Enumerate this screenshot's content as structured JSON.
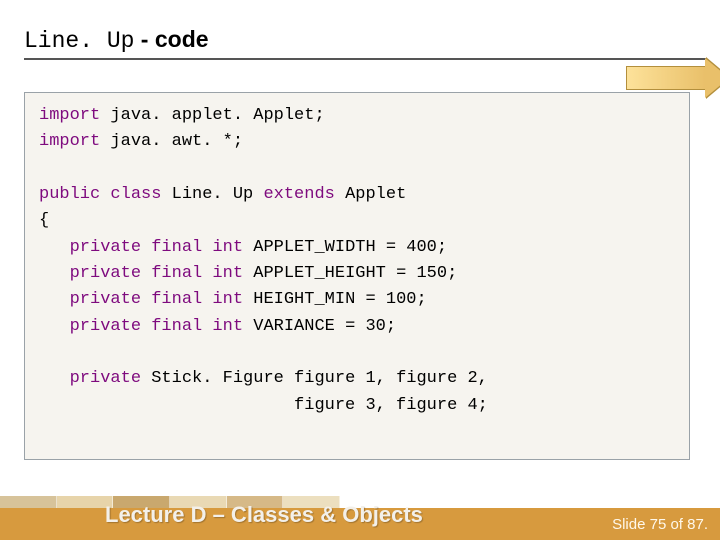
{
  "heading": {
    "mono": "Line. Up",
    "suffix": " - code"
  },
  "code": {
    "tokens": [
      {
        "t": "import",
        "k": true
      },
      {
        "t": " java. applet. Applet;\n"
      },
      {
        "t": "import",
        "k": true
      },
      {
        "t": " java. awt. *;\n"
      },
      {
        "t": "\n"
      },
      {
        "t": "public class",
        "k": true
      },
      {
        "t": " Line. Up "
      },
      {
        "t": "extends",
        "k": true
      },
      {
        "t": " Applet\n"
      },
      {
        "t": "{\n"
      },
      {
        "t": "   "
      },
      {
        "t": "private final int",
        "k": true
      },
      {
        "t": " APPLET_WIDTH = 400;\n"
      },
      {
        "t": "   "
      },
      {
        "t": "private final int",
        "k": true
      },
      {
        "t": " APPLET_HEIGHT = 150;\n"
      },
      {
        "t": "   "
      },
      {
        "t": "private final int",
        "k": true
      },
      {
        "t": " HEIGHT_MIN = 100;\n"
      },
      {
        "t": "   "
      },
      {
        "t": "private final int",
        "k": true
      },
      {
        "t": " VARIANCE = 30;\n"
      },
      {
        "t": "\n"
      },
      {
        "t": "   "
      },
      {
        "t": "private",
        "k": true
      },
      {
        "t": " Stick. Figure figure 1, figure 2,\n"
      },
      {
        "t": "                         figure 3, figure 4;\n"
      }
    ]
  },
  "footer": {
    "lecture": "Lecture D – Classes & Objects",
    "pageno": "Slide 75 of 87."
  }
}
